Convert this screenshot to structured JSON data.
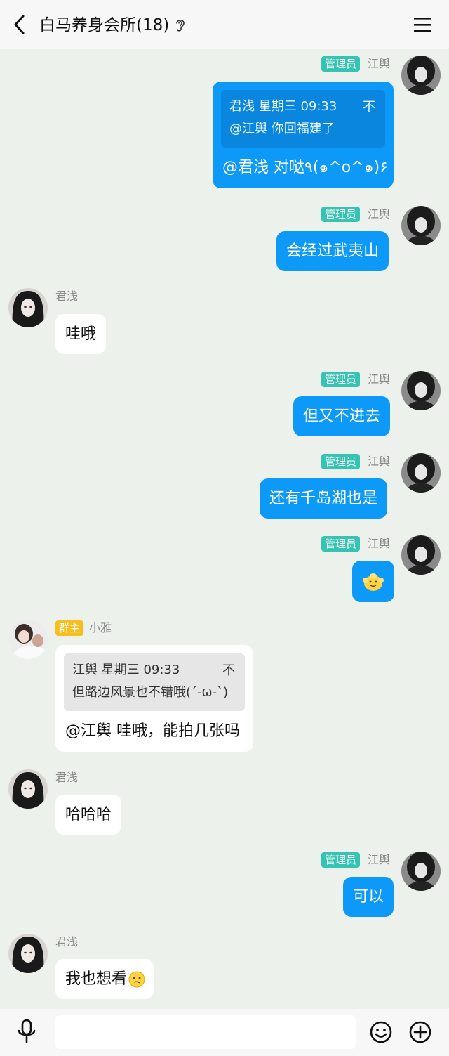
{
  "header": {
    "title": "白马养身会所(18)"
  },
  "roles": {
    "admin": "管理员",
    "owner": "群主"
  },
  "users": {
    "me": "江舆",
    "junqian": "君浅",
    "xiaoya": "小雅"
  },
  "messages": [
    {
      "quote": {
        "header": "君浅 星期三 09:33",
        "text": "@江舆 你回福建了",
        "mark": "不"
      },
      "text": "@君浅 对哒٩(๑^o^๑)۶"
    },
    {
      "text": "会经过武夷山"
    },
    {
      "text": "哇哦"
    },
    {
      "text": "但又不进去"
    },
    {
      "text": "还有千岛湖也是"
    },
    {
      "icon": "thumbs-up-emoji"
    },
    {
      "quote": {
        "header": "江舆 星期三 09:33",
        "text": "但路边风景也不错哦(´-ω-`)",
        "mark": "不"
      },
      "text": "@江舆 哇哦，能拍几张吗"
    },
    {
      "text": "哈哈哈"
    },
    {
      "text": "可以"
    },
    {
      "text": "我也想看",
      "icon": "confused-face-emoji"
    }
  ],
  "input": {
    "placeholder": ""
  },
  "icons": [
    "back-arrow-icon",
    "ear-icon",
    "menu-icon",
    "microphone-icon",
    "emoji-icon",
    "plus-icon"
  ],
  "colors": {
    "my_bubble": "#0d99f8",
    "admin_tag": "#35c3b3",
    "owner_tag": "#f6be1f",
    "background": "#edf1ec"
  }
}
